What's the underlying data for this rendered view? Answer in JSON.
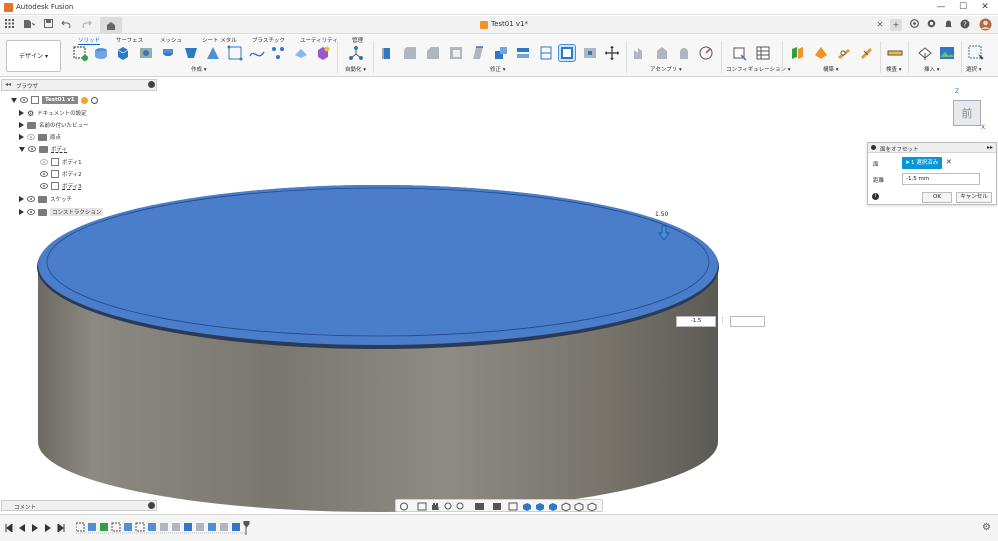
{
  "window": {
    "app_title": "Autodesk Fusion",
    "minimize": "—",
    "maximize": "☐",
    "close": "✕"
  },
  "tabbar": {
    "document_tab": "Test01 v1*",
    "icons": [
      "grid-icon",
      "file-icon",
      "undo-icon",
      "redo-icon",
      "home-icon",
      "close-tab-icon",
      "add-tab-icon",
      "extensions-icon",
      "jobs-icon",
      "notifications-icon",
      "help-icon",
      "avatar"
    ]
  },
  "ribbon": {
    "workspace": "デザイン ▾",
    "tabs": [
      "ソリッド",
      "サーフェス",
      "メッシュ",
      "シート メタル",
      "プラスチック",
      "ユーティリティ",
      "管理"
    ],
    "active_tab": "ソリッド",
    "groups": [
      "作成 ▾",
      "自動化 ▾",
      "修正 ▾",
      "アセンブリ ▾",
      "コンフィギュレーション ▾",
      "構築 ▾",
      "検査 ▾",
      "挿入 ▾",
      "選択 ▾"
    ]
  },
  "browser": {
    "title": "ブラウザ",
    "items": [
      {
        "label": "Test01 v1",
        "level": 0,
        "expanded": true
      },
      {
        "label": "ドキュメントの設定",
        "level": 1
      },
      {
        "label": "名前の付いたビュー",
        "level": 1
      },
      {
        "label": "原点",
        "level": 1
      },
      {
        "label": "ボディ",
        "level": 1,
        "expanded": true
      },
      {
        "label": "ボディ1",
        "level": 2
      },
      {
        "label": "ボディ2",
        "level": 2
      },
      {
        "label": "ボディ3",
        "level": 2
      },
      {
        "label": "スケッチ",
        "level": 1
      },
      {
        "label": "コンストラクション",
        "level": 1
      }
    ]
  },
  "viewcube": {
    "face_label": "前",
    "axis_z": "Z",
    "axis_x": "X"
  },
  "dialog": {
    "title": "面をオフセット",
    "face_label": "面",
    "selection": "1 選択済み",
    "distance_label": "距離",
    "distance_value": "-1.5 mm",
    "ok": "OK",
    "cancel": "キャンセル"
  },
  "canvas": {
    "dimension_label": "1.50",
    "input_value": "-1.5",
    "face_color": "#4a7ecb",
    "body_color": "#8a8780"
  },
  "comments": {
    "label": "コメント"
  }
}
